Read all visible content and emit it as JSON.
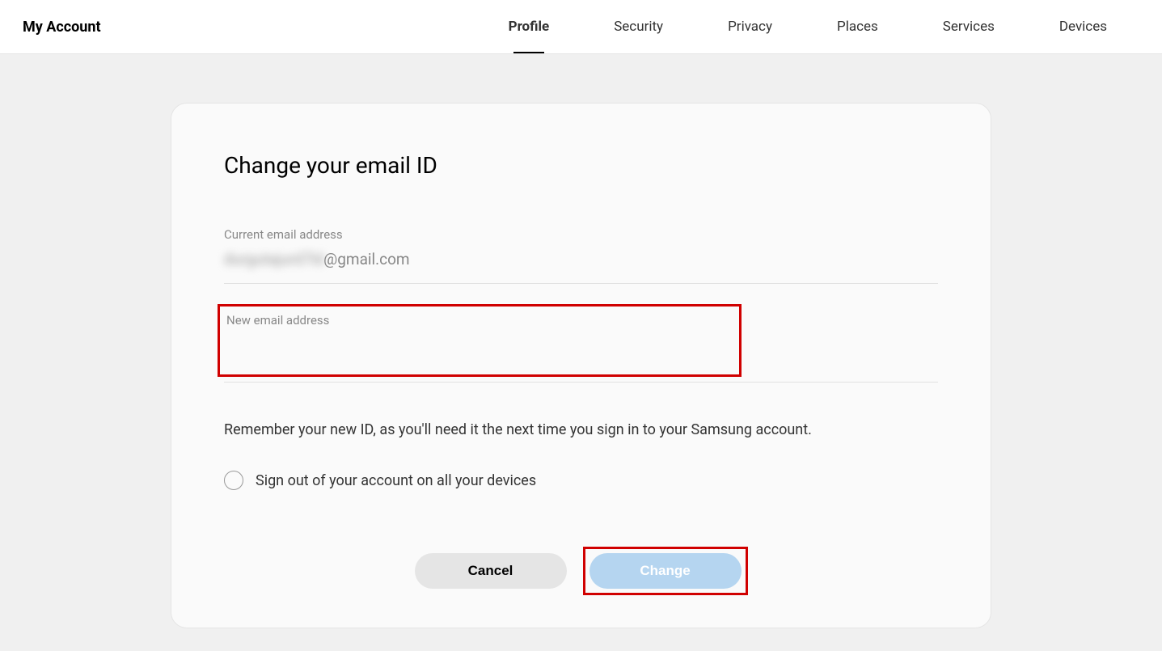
{
  "header": {
    "title": "My Account",
    "tabs": [
      {
        "label": "Profile",
        "active": true
      },
      {
        "label": "Security",
        "active": false
      },
      {
        "label": "Privacy",
        "active": false
      },
      {
        "label": "Places",
        "active": false
      },
      {
        "label": "Services",
        "active": false
      },
      {
        "label": "Devices",
        "active": false
      }
    ]
  },
  "page": {
    "title": "Change your email ID",
    "current_email_label": "Current email address",
    "current_email_blurred": "durgutajurd7ld",
    "current_email_visible": "@gmail.com",
    "new_email_label": "New email address",
    "new_email_value": "",
    "info_text": "Remember your new ID, as you'll need it the next time you sign in to your Samsung account.",
    "checkbox_label": "Sign out of your account on all your devices",
    "checkbox_checked": false,
    "cancel_button": "Cancel",
    "change_button": "Change"
  },
  "highlights": {
    "new_email_input": true,
    "change_button": true
  }
}
